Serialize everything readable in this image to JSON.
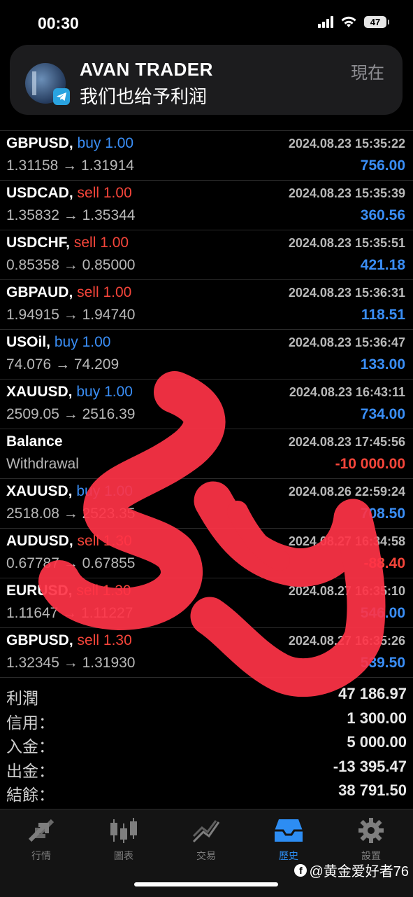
{
  "status_bar": {
    "time": "00:30",
    "battery": "47"
  },
  "notification": {
    "app": "AVAN TRADER",
    "message": "我们也给予利润",
    "time": "現在"
  },
  "trades": [
    {
      "symbol": "GBPUSD,",
      "side": "buy",
      "lot": "1.00",
      "date": "2024.08.23 15:35:22",
      "prices": "1.31158 → 1.31914",
      "profit": "756.00"
    },
    {
      "symbol": "USDCAD,",
      "side": "sell",
      "lot": "1.00",
      "date": "2024.08.23 15:35:39",
      "prices": "1.35832 → 1.35344",
      "profit": "360.56"
    },
    {
      "symbol": "USDCHF,",
      "side": "sell",
      "lot": "1.00",
      "date": "2024.08.23 15:35:51",
      "prices": "0.85358 → 0.85000",
      "profit": "421.18"
    },
    {
      "symbol": "GBPAUD,",
      "side": "sell",
      "lot": "1.00",
      "date": "2024.08.23 15:36:31",
      "prices": "1.94915 → 1.94740",
      "profit": "118.51"
    },
    {
      "symbol": "USOil,",
      "side": "buy",
      "lot": "1.00",
      "date": "2024.08.23 15:36:47",
      "prices": "74.076 → 74.209",
      "profit": "133.00"
    },
    {
      "symbol": "XAUUSD,",
      "side": "buy",
      "lot": "1.00",
      "date": "2024.08.23 16:43:11",
      "prices": "2509.05 → 2516.39",
      "profit": "734.00"
    },
    {
      "symbol": "Balance",
      "side": "",
      "lot": "",
      "date": "2024.08.23 17:45:56",
      "prices": "Withdrawal",
      "profit": "-10 000.00"
    },
    {
      "symbol": "XAUUSD,",
      "side": "buy",
      "lot": "1.00",
      "date": "2024.08.26 22:59:24",
      "prices": "2518.08 → 2523.35",
      "profit": "708.50"
    },
    {
      "symbol": "AUDUSD,",
      "side": "sell",
      "lot": "1.30",
      "date": "2024.08.27 16:34:58",
      "prices": "0.67787 → 0.67855",
      "profit": "-88.40"
    },
    {
      "symbol": "EURUSD,",
      "side": "sell",
      "lot": "1.30",
      "date": "2024.08.27 16:35:10",
      "prices": "1.11647 → 1.11227",
      "profit": "546.00"
    },
    {
      "symbol": "GBPUSD,",
      "side": "sell",
      "lot": "1.30",
      "date": "2024.08.27 16:35:26",
      "prices": "1.32345 → 1.31930",
      "profit": "539.50"
    }
  ],
  "summary": [
    {
      "label": "利潤",
      "value": "47 186.97"
    },
    {
      "label": "信用：",
      "value": "1 300.00"
    },
    {
      "label": "入金：",
      "value": "5 000.00"
    },
    {
      "label": "出金：",
      "value": "-13 395.47"
    },
    {
      "label": "結餘：",
      "value": "38 791.50"
    }
  ],
  "tabs": [
    {
      "label": "行情",
      "icon": "quotes-arrows-icon"
    },
    {
      "label": "圖表",
      "icon": "candlestick-chart-icon"
    },
    {
      "label": "交易",
      "icon": "trade-trend-icon"
    },
    {
      "label": "歷史",
      "icon": "history-inbox-icon"
    },
    {
      "label": "設置",
      "icon": "settings-gear-icon"
    }
  ],
  "active_tab": "歷史",
  "watermark": "@黄金爱好者76",
  "colors": {
    "buy": "#3a8ef6",
    "sell": "#f5453a",
    "accent": "#2d8df3",
    "scribble": "#ff3347"
  }
}
